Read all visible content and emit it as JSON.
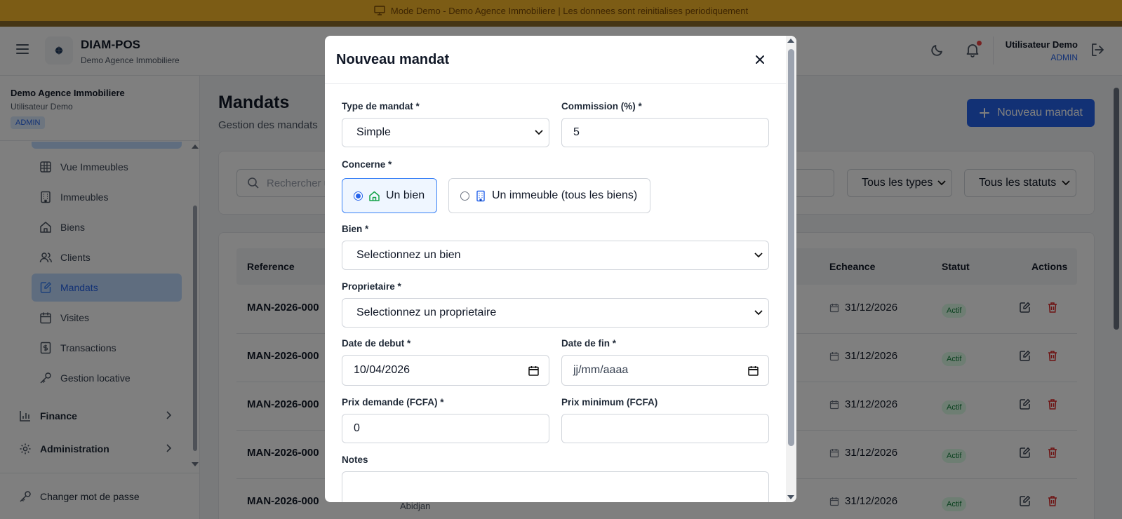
{
  "banner": {
    "text": "Mode Demo - Demo Agence Immobiliere | Les donnees sont reinitialises periodiquement"
  },
  "topbar": {
    "brand": "DIAM-POS",
    "subtitle": "Demo Agence Immobiliere",
    "user_name": "Utilisateur Demo",
    "user_role": "ADMIN"
  },
  "sidebar": {
    "org": "Demo Agence Immobiliere",
    "user": "Utilisateur Demo",
    "role_badge": "ADMIN",
    "items": [
      {
        "label": "Vue Immeubles",
        "icon": "grid-icon"
      },
      {
        "label": "Immeubles",
        "icon": "building-icon"
      },
      {
        "label": "Biens",
        "icon": "home-icon"
      },
      {
        "label": "Clients",
        "icon": "users-icon"
      },
      {
        "label": "Mandats",
        "icon": "edit-file-icon",
        "active": true
      },
      {
        "label": "Visites",
        "icon": "calendar-icon"
      },
      {
        "label": "Transactions",
        "icon": "receipt-icon"
      },
      {
        "label": "Gestion locative",
        "icon": "key-icon"
      }
    ],
    "groups": [
      {
        "label": "Finance",
        "icon": "bar-chart-icon"
      },
      {
        "label": "Administration",
        "icon": "gear-icon"
      }
    ],
    "footer": "Changer mot de passe"
  },
  "main": {
    "title": "Mandats",
    "subtitle": "Gestion des mandats",
    "new_button": "Nouveau mandat",
    "search_placeholder": "Rechercher u",
    "filter_types": "Tous les types",
    "filter_statuts": "Tous les statuts",
    "columns": {
      "reference": "Reference",
      "echeance": "Echeance",
      "statut": "Statut",
      "actions": "Actions"
    },
    "rows": [
      {
        "reference": "MAN-2026-000",
        "echeance": "31/12/2026",
        "statut": "Actif"
      },
      {
        "reference": "MAN-2026-000",
        "echeance": "31/12/2026",
        "statut": "Actif"
      },
      {
        "reference": "MAN-2026-000",
        "echeance": "31/12/2026",
        "statut": "Actif"
      },
      {
        "reference": "MAN-2026-000",
        "echeance": "31/12/2026",
        "statut": "Actif"
      },
      {
        "reference": "MAN-2026-000",
        "echeance": "31/12/2026",
        "statut": "Actif"
      }
    ],
    "partial_text": "Abidjan"
  },
  "modal": {
    "title": "Nouveau mandat",
    "type_label": "Type de mandat *",
    "type_value": "Simple",
    "commission_label": "Commission (%) *",
    "commission_value": "5",
    "concerne_label": "Concerne *",
    "option_bien": "Un bien",
    "option_immeuble": "Un immeuble (tous les biens)",
    "bien_label": "Bien *",
    "bien_value": "Selectionnez un bien",
    "proprietaire_label": "Proprietaire *",
    "proprietaire_value": "Selectionnez un proprietaire",
    "date_debut_label": "Date de debut *",
    "date_debut_value": "10/04/2026",
    "date_fin_label": "Date de fin *",
    "date_fin_placeholder": "jj/mm/aaaa",
    "prix_demande_label": "Prix demande (FCFA) *",
    "prix_demande_value": "0",
    "prix_minimum_label": "Prix minimum (FCFA)",
    "prix_minimum_value": "",
    "notes_label": "Notes"
  },
  "colors": {
    "primary": "#2563eb",
    "banner": "#f9b82a",
    "success": "#15803d",
    "danger": "#dc2626"
  }
}
